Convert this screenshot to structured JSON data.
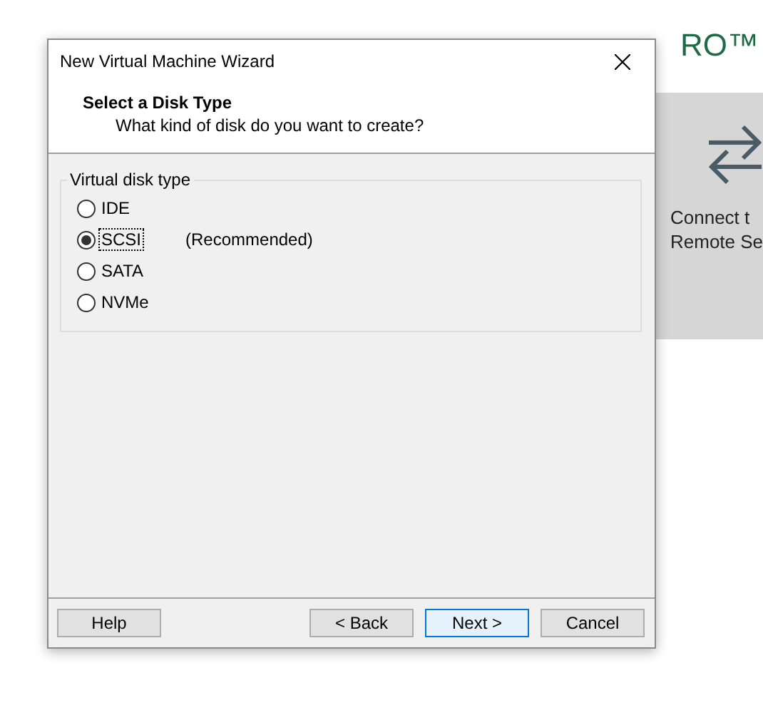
{
  "background": {
    "brand_text": "RO™",
    "tile_lines": [
      "Connect t",
      "Remote Se"
    ]
  },
  "window": {
    "title": "New Virtual Machine Wizard"
  },
  "header": {
    "title": "Select a Disk Type",
    "subtitle": "What kind of disk do you want to create?"
  },
  "group": {
    "label": "Virtual disk type",
    "options": [
      {
        "label": "IDE",
        "selected": false,
        "focused": false
      },
      {
        "label": "SCSI",
        "selected": true,
        "focused": true,
        "note": "(Recommended)"
      },
      {
        "label": "SATA",
        "selected": false,
        "focused": false
      },
      {
        "label": "NVMe",
        "selected": false,
        "focused": false
      }
    ]
  },
  "buttons": [
    {
      "label": "Help",
      "default": false
    },
    {
      "label": "< Back",
      "default": false
    },
    {
      "label": "Next >",
      "default": true
    },
    {
      "label": "Cancel",
      "default": false
    }
  ]
}
